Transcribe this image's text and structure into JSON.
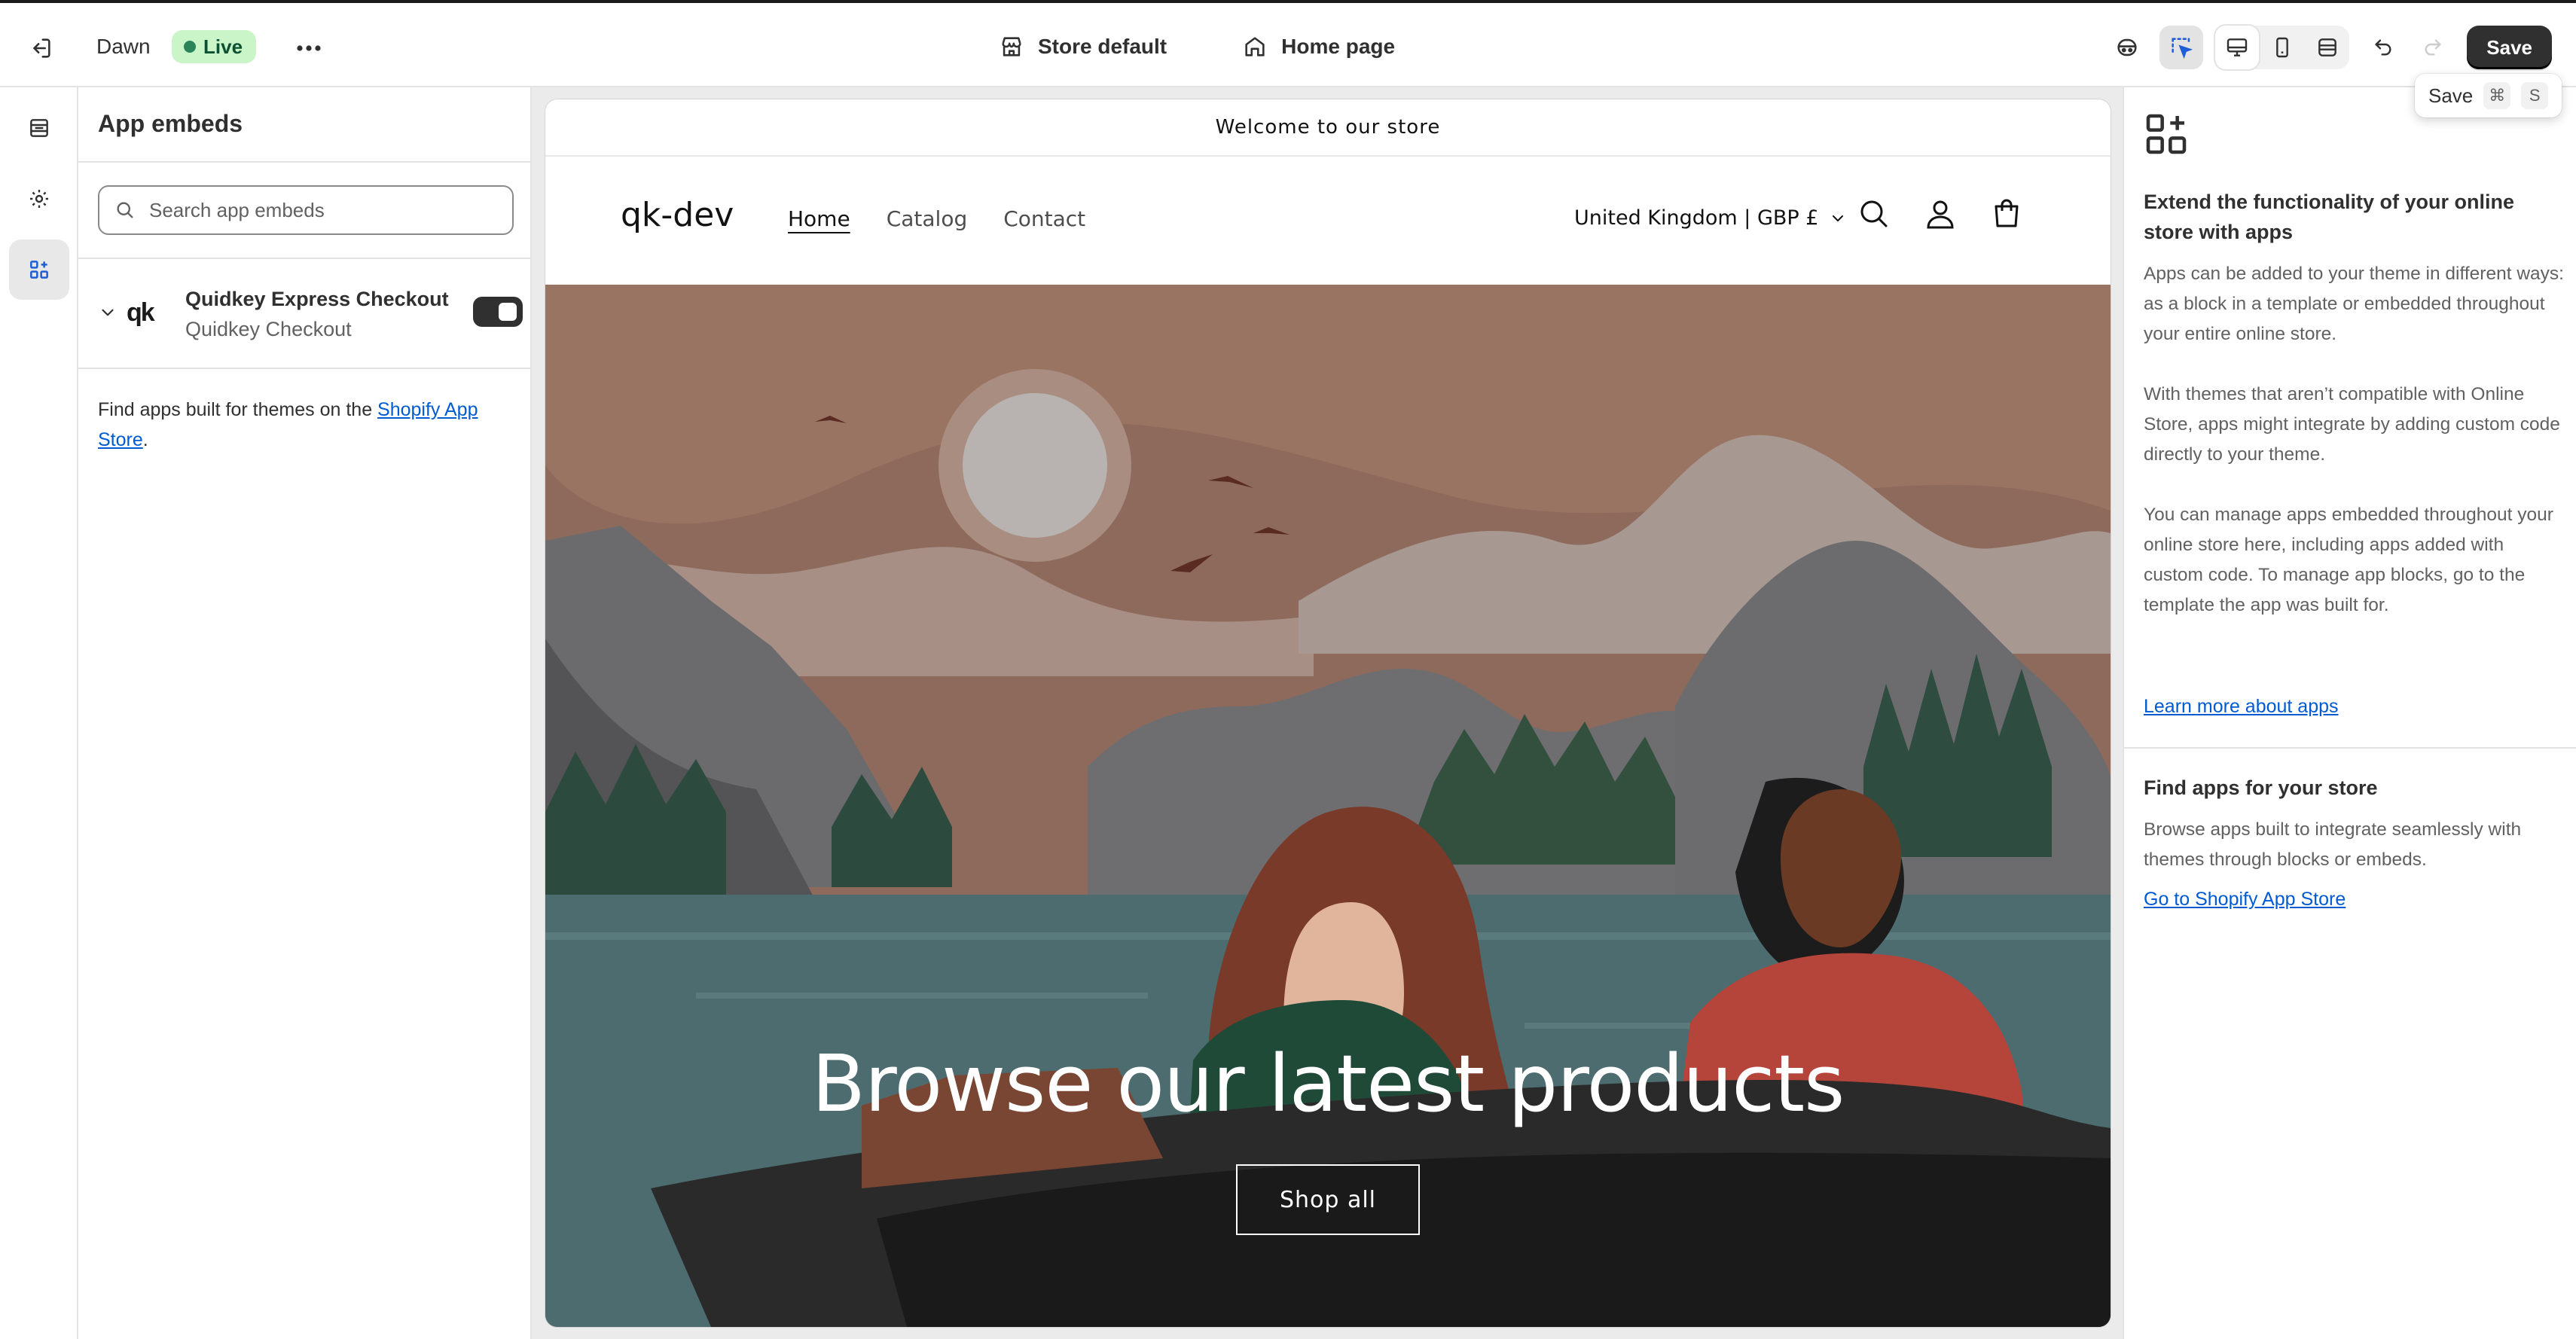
{
  "topbar": {
    "theme_name": "Dawn",
    "live_badge": "Live",
    "store_picker": "Store default",
    "page_picker": "Home page",
    "save_label": "Save"
  },
  "tooltip": {
    "label": "Save",
    "key1": "⌘",
    "key2": "S"
  },
  "sidebar": {
    "title": "App embeds",
    "search_placeholder": "Search app embeds",
    "app": {
      "name": "Quidkey Express Checkout",
      "sub": "Quidkey Checkout",
      "logo": "qk",
      "enabled": true
    },
    "find_text": "Find apps built for themes on the ",
    "find_link": "Shopify App Store",
    "find_end": "."
  },
  "preview": {
    "announcement": "Welcome to our store",
    "logo": "qk-dev",
    "nav": [
      "Home",
      "Catalog",
      "Contact"
    ],
    "locale": "United Kingdom | GBP £",
    "hero_title": "Browse our latest products",
    "hero_button": "Shop all"
  },
  "rpanel": {
    "heading1": "Extend the functionality of your online store with apps",
    "p1": "Apps can be added to your theme in different ways: as a block in a template or embedded throughout your entire online store.",
    "p2": "With themes that aren’t compatible with Online Store, apps might integrate by adding custom code directly to your theme.",
    "p3": "You can manage apps embedded throughout your online store here, including apps added with custom code. To manage app blocks, go to the template the app was built for.",
    "link1": "Learn more about apps",
    "heading2": "Find apps for your store",
    "p4": "Browse apps built to integrate seamlessly with themes through blocks or embeds.",
    "link2": "Go to Shopify App Store"
  },
  "colors": {
    "accent_link": "#005bd3",
    "save_bg": "#303030",
    "live_bg": "#c9f5c8"
  }
}
